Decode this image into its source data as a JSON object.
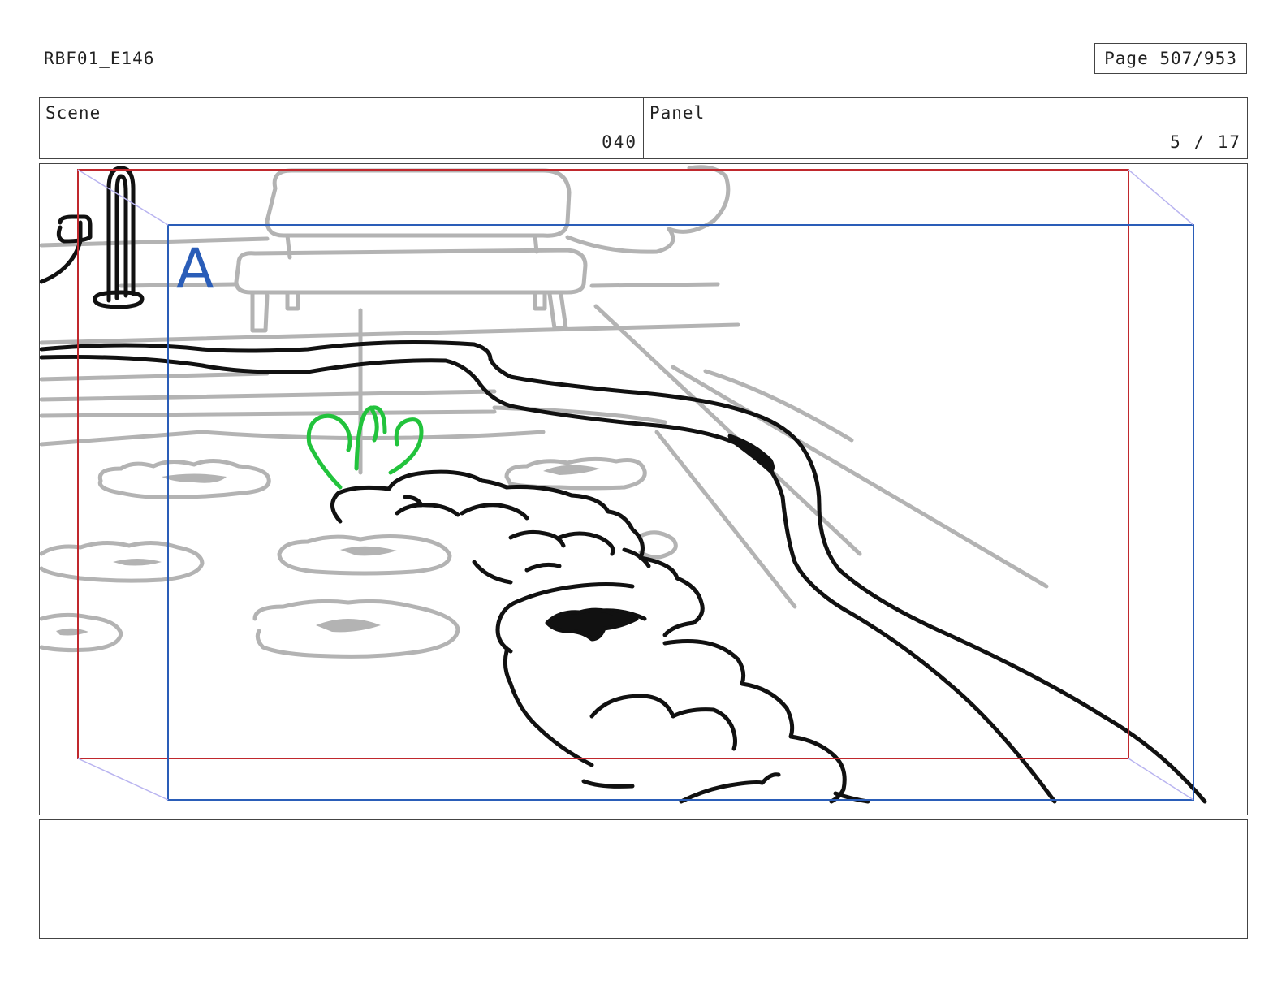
{
  "header": {
    "episode_code": "RBF01_E146",
    "page_indicator": "Page 507/953"
  },
  "info": {
    "scene_label": "Scene",
    "scene_value": "040",
    "panel_label": "Panel",
    "panel_value": "5 / 17"
  },
  "panel": {
    "frame_marker": "A",
    "colors": {
      "action_safe": "#c0282d",
      "camera_frame": "#2a5db8",
      "sketch_lines": "#b3b3b3",
      "ink_lines": "#111111",
      "effect_lines": "#22c33c"
    }
  },
  "notes": {
    "text": ""
  }
}
